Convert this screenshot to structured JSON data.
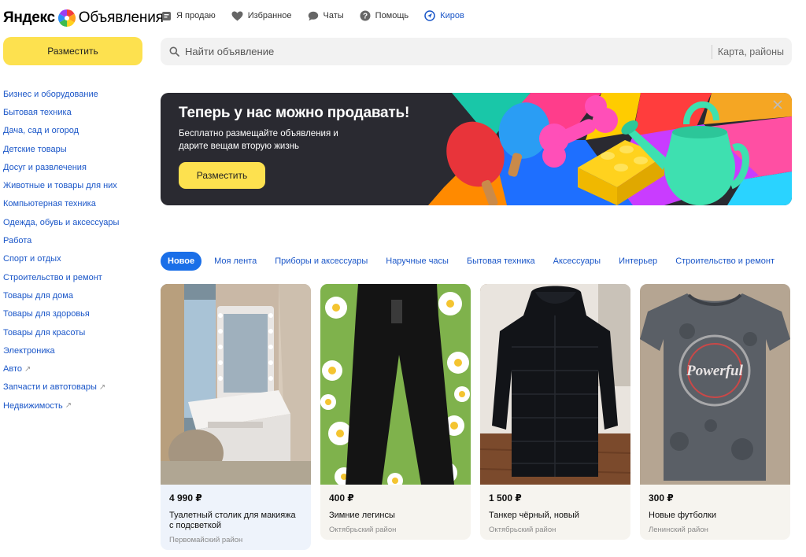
{
  "header": {
    "logo_brand": "Яндекс",
    "logo_service": "Объявления",
    "nav": [
      {
        "label": "Я продаю",
        "icon": "sell-icon"
      },
      {
        "label": "Избранное",
        "icon": "heart-icon"
      },
      {
        "label": "Чаты",
        "icon": "chat-icon"
      },
      {
        "label": "Помощь",
        "icon": "help-icon"
      },
      {
        "label": "Киров",
        "icon": "location-icon"
      }
    ]
  },
  "place_button_label": "Разместить",
  "search": {
    "placeholder": "Найти объявление",
    "map_link": "Карта, районы"
  },
  "sidebar": {
    "categories": [
      {
        "label": "Бизнес и оборудование"
      },
      {
        "label": "Бытовая техника"
      },
      {
        "label": "Дача, сад и огород"
      },
      {
        "label": "Детские товары"
      },
      {
        "label": "Досуг и развлечения"
      },
      {
        "label": "Животные и товары для них"
      },
      {
        "label": "Компьютерная техника"
      },
      {
        "label": "Одежда, обувь и аксессуары"
      },
      {
        "label": "Работа"
      },
      {
        "label": "Спорт и отдых"
      },
      {
        "label": "Строительство и ремонт"
      },
      {
        "label": "Товары для дома"
      },
      {
        "label": "Товары для здоровья"
      },
      {
        "label": "Товары для красоты"
      },
      {
        "label": "Электроника"
      },
      {
        "label": "Авто",
        "external": true
      },
      {
        "label": "Запчасти и автотовары",
        "external": true
      },
      {
        "label": "Недвижимость",
        "external": true
      }
    ],
    "external_glyph": "↗"
  },
  "banner": {
    "title": "Теперь у нас можно продавать!",
    "subtitle": "Бесплатно размещайте объявления и дарите вещам вторую жизнь",
    "button_label": "Разместить"
  },
  "tabs": [
    {
      "label": "Новое",
      "active": true
    },
    {
      "label": "Моя лента"
    },
    {
      "label": "Приборы и аксессуары"
    },
    {
      "label": "Наручные часы"
    },
    {
      "label": "Бытовая техника"
    },
    {
      "label": "Аксессуары"
    },
    {
      "label": "Интерьер"
    },
    {
      "label": "Строительство и ремонт"
    }
  ],
  "listings": [
    {
      "price": "4 990 ₽",
      "title": "Туалетный столик для макияжа с подсветкой",
      "district": "Первомайский район"
    },
    {
      "price": "400 ₽",
      "title": "Зимние легинсы",
      "district": "Октябрьский район"
    },
    {
      "price": "1 500 ₽",
      "title": "Танкер чёрный, новый",
      "district": "Октябрьский район"
    },
    {
      "price": "300 ₽",
      "title": "Новые футболки",
      "district": "Ленинский район"
    }
  ],
  "photo_text": {
    "tshirt_print": "Powerful"
  },
  "colors": {
    "accent_yellow": "#fde14f",
    "link_blue": "#1a56c8",
    "active_tab_blue": "#1a6fe8",
    "banner_dark": "#2a2a31"
  }
}
